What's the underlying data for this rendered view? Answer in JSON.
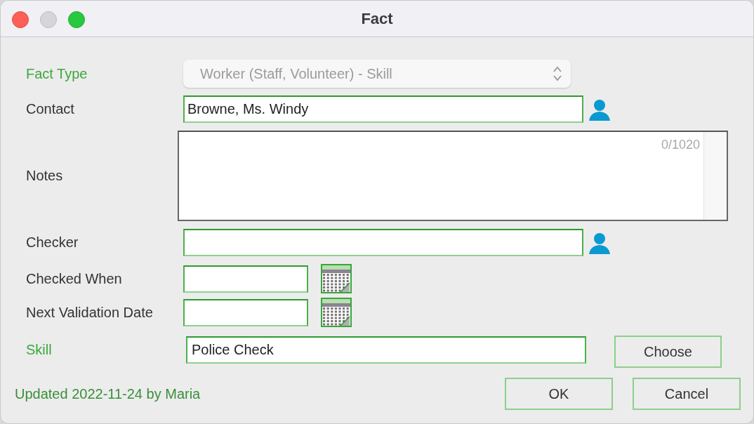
{
  "window": {
    "title": "Fact"
  },
  "fields": [
    {
      "kind": "select",
      "label": "Fact Type",
      "required": true,
      "value": "Worker (Staff, Volunteer) - Skill",
      "disabled": true
    },
    {
      "kind": "contact",
      "label": "Contact",
      "required": false,
      "value": "Browne, Ms. Windy"
    },
    {
      "kind": "notes",
      "label": "Notes",
      "required": false,
      "counter": "0/1020"
    },
    {
      "kind": "contact",
      "label": "Checker",
      "required": false
    },
    {
      "kind": "date",
      "label": "Checked When",
      "required": false
    },
    {
      "kind": "date",
      "label": "Next Validation Date",
      "required": false
    },
    {
      "kind": "chooser",
      "label": "Skill",
      "required": true,
      "value": "Police Check",
      "button": "Choose"
    }
  ],
  "footer": {
    "status": "Updated 2022-11-24 by Maria",
    "buttons": [
      "OK",
      "Cancel"
    ]
  }
}
